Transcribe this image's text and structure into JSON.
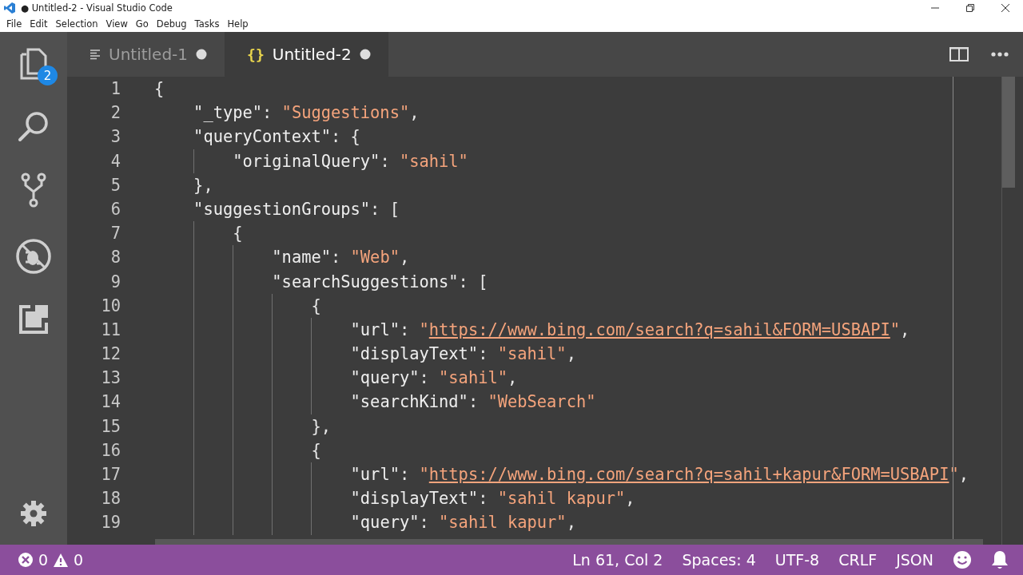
{
  "window": {
    "title": "● Untitled-2 - Visual Studio Code"
  },
  "menu": [
    "File",
    "Edit",
    "Selection",
    "View",
    "Go",
    "Debug",
    "Tasks",
    "Help"
  ],
  "activity_bar": {
    "explorer_badge": "2"
  },
  "tabs": [
    {
      "label": "Untitled-1",
      "kind": "text",
      "selected": false,
      "dirty": true
    },
    {
      "label": "Untitled-2",
      "kind": "json",
      "icon": "{}",
      "selected": true,
      "dirty": true
    }
  ],
  "editor": {
    "lines": [
      {
        "number": "1",
        "tokens": [
          {
            "kind": "punct",
            "text": "{"
          }
        ]
      },
      {
        "number": "2",
        "tokens": [
          {
            "kind": "key",
            "text": "    \"_type\""
          },
          {
            "kind": "punct",
            "text": ": "
          },
          {
            "kind": "string",
            "text": "\"Suggestions\""
          },
          {
            "kind": "punct",
            "text": ","
          }
        ]
      },
      {
        "number": "3",
        "tokens": [
          {
            "kind": "key",
            "text": "    \"queryContext\""
          },
          {
            "kind": "punct",
            "text": ": {"
          }
        ]
      },
      {
        "number": "4",
        "tokens": [
          {
            "kind": "key",
            "text": "        \"originalQuery\""
          },
          {
            "kind": "punct",
            "text": ": "
          },
          {
            "kind": "string",
            "text": "\"sahil\""
          }
        ]
      },
      {
        "number": "5",
        "tokens": [
          {
            "kind": "punct",
            "text": "    },"
          }
        ]
      },
      {
        "number": "6",
        "tokens": [
          {
            "kind": "key",
            "text": "    \"suggestionGroups\""
          },
          {
            "kind": "punct",
            "text": ": ["
          }
        ]
      },
      {
        "number": "7",
        "tokens": [
          {
            "kind": "punct",
            "text": "        {"
          }
        ]
      },
      {
        "number": "8",
        "tokens": [
          {
            "kind": "key",
            "text": "            \"name\""
          },
          {
            "kind": "punct",
            "text": ": "
          },
          {
            "kind": "string",
            "text": "\"Web\""
          },
          {
            "kind": "punct",
            "text": ","
          }
        ]
      },
      {
        "number": "9",
        "tokens": [
          {
            "kind": "key",
            "text": "            \"searchSuggestions\""
          },
          {
            "kind": "punct",
            "text": ": ["
          }
        ]
      },
      {
        "number": "10",
        "tokens": [
          {
            "kind": "punct",
            "text": "                {"
          }
        ]
      },
      {
        "number": "11",
        "tokens": [
          {
            "kind": "key",
            "text": "                    \"url\""
          },
          {
            "kind": "punct",
            "text": ": "
          },
          {
            "kind": "string",
            "text": "\""
          },
          {
            "kind": "link",
            "text": "https://www.bing.com/search?q=sahil&FORM=USBAPI"
          },
          {
            "kind": "string",
            "text": "\""
          },
          {
            "kind": "punct",
            "text": ","
          }
        ]
      },
      {
        "number": "12",
        "tokens": [
          {
            "kind": "key",
            "text": "                    \"displayText\""
          },
          {
            "kind": "punct",
            "text": ": "
          },
          {
            "kind": "string",
            "text": "\"sahil\""
          },
          {
            "kind": "punct",
            "text": ","
          }
        ]
      },
      {
        "number": "13",
        "tokens": [
          {
            "kind": "key",
            "text": "                    \"query\""
          },
          {
            "kind": "punct",
            "text": ": "
          },
          {
            "kind": "string",
            "text": "\"sahil\""
          },
          {
            "kind": "punct",
            "text": ","
          }
        ]
      },
      {
        "number": "14",
        "tokens": [
          {
            "kind": "key",
            "text": "                    \"searchKind\""
          },
          {
            "kind": "punct",
            "text": ": "
          },
          {
            "kind": "string",
            "text": "\"WebSearch\""
          }
        ]
      },
      {
        "number": "15",
        "tokens": [
          {
            "kind": "punct",
            "text": "                },"
          }
        ]
      },
      {
        "number": "16",
        "tokens": [
          {
            "kind": "punct",
            "text": "                {"
          }
        ]
      },
      {
        "number": "17",
        "tokens": [
          {
            "kind": "key",
            "text": "                    \"url\""
          },
          {
            "kind": "punct",
            "text": ": "
          },
          {
            "kind": "string",
            "text": "\""
          },
          {
            "kind": "link",
            "text": "https://www.bing.com/search?q=sahil+kapur&FORM=USBAPI"
          },
          {
            "kind": "string",
            "text": "\""
          },
          {
            "kind": "punct",
            "text": ","
          }
        ]
      },
      {
        "number": "18",
        "tokens": [
          {
            "kind": "key",
            "text": "                    \"displayText\""
          },
          {
            "kind": "punct",
            "text": ": "
          },
          {
            "kind": "string",
            "text": "\"sahil kapur\""
          },
          {
            "kind": "punct",
            "text": ","
          }
        ]
      },
      {
        "number": "19",
        "tokens": [
          {
            "kind": "key",
            "text": "                    \"query\""
          },
          {
            "kind": "punct",
            "text": ": "
          },
          {
            "kind": "string",
            "text": "\"sahil kapur\""
          },
          {
            "kind": "punct",
            "text": ","
          }
        ]
      }
    ]
  },
  "status_bar": {
    "errors": "0",
    "warnings": "0",
    "items": [
      "Ln 61, Col 2",
      "Spaces: 4",
      "UTF-8",
      "CRLF",
      "JSON"
    ]
  }
}
